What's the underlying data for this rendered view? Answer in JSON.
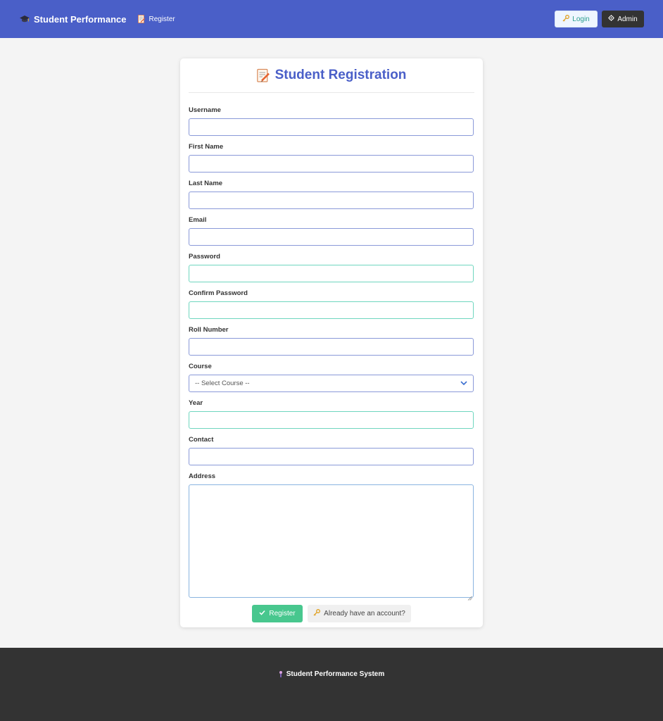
{
  "navbar": {
    "brand_icon": "graduation-cap-icon",
    "brand": "Student Performance",
    "register_icon": "memo-icon",
    "register_link": "Register",
    "login_icon": "key-icon",
    "login_label": "Login",
    "admin_icon": "gear-icon",
    "admin_label": "Admin",
    "colors": {
      "primary": "#4a5fc8",
      "admin_bg": "#333333",
      "login_text": "#2a9d8f"
    }
  },
  "card": {
    "title_icon": "memo-icon",
    "title": "Student Registration",
    "fields": {
      "username": {
        "label": "Username",
        "value": ""
      },
      "first_name": {
        "label": "First Name",
        "value": ""
      },
      "last_name": {
        "label": "Last Name",
        "value": ""
      },
      "email": {
        "label": "Email",
        "value": ""
      },
      "password": {
        "label": "Password",
        "value": ""
      },
      "confirm_password": {
        "label": "Confirm Password",
        "value": ""
      },
      "roll_number": {
        "label": "Roll Number",
        "value": ""
      },
      "course": {
        "label": "Course",
        "selected": "-- Select Course --"
      },
      "year": {
        "label": "Year",
        "value": ""
      },
      "contact": {
        "label": "Contact",
        "value": ""
      },
      "address": {
        "label": "Address",
        "value": ""
      }
    },
    "register_icon": "checkmark-icon",
    "register_label": "Register",
    "account_icon": "key-icon",
    "account_label": "Already have an account?",
    "colors": {
      "register_bg": "#48c78e",
      "title": "#4a5fc8"
    }
  },
  "footer": {
    "icon": "graduation-icon",
    "text": "Student Performance System"
  }
}
